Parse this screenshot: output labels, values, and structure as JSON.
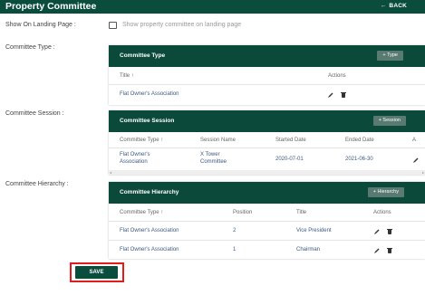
{
  "header": {
    "title": "Property Committee",
    "back_label": "BACK"
  },
  "landing": {
    "label": "Show On Landing Page :",
    "checkbox_text": "Show property committee on landing page"
  },
  "labels": {
    "committee_type": "Committee Type :",
    "committee_session": "Committee Session :",
    "committee_hierarchy": "Committee Hierarchy :"
  },
  "type_card": {
    "title": "Committee Type",
    "add_label": "+ Type",
    "columns": [
      "Title ↑",
      "Actions"
    ],
    "rows": [
      {
        "title": "Flat Owner's Association"
      }
    ]
  },
  "session_card": {
    "title": "Committee Session",
    "add_label": "+ Session",
    "columns": [
      "Committee Type ↑",
      "Session Name",
      "Started Date",
      "Ended Date",
      "A"
    ],
    "rows": [
      {
        "type_line1": "Flat Owner's",
        "type_line2": "Association",
        "name_line1": "X Tower",
        "name_line2": "Committee",
        "start": "2020-07-01",
        "end": "2021-06-30"
      }
    ]
  },
  "hierarchy_card": {
    "title": "Committee Hierarchy",
    "add_label": "+ Hierarchy",
    "columns": [
      "Committee Type ↑",
      "Position",
      "Title",
      "Actions"
    ],
    "rows": [
      {
        "type": "Flat Owner's Association",
        "position": "2",
        "title": "Vice President"
      },
      {
        "type": "Flat Owner's Association",
        "position": "1",
        "title": "Chairman"
      }
    ]
  },
  "save_label": "SAVE",
  "colors": {
    "primary": "#0a4d3c",
    "highlight": "#e21b1b",
    "link": "#3d5a80"
  },
  "icons": [
    "back-arrow-icon",
    "edit-pencil-icon",
    "delete-trash-icon"
  ]
}
